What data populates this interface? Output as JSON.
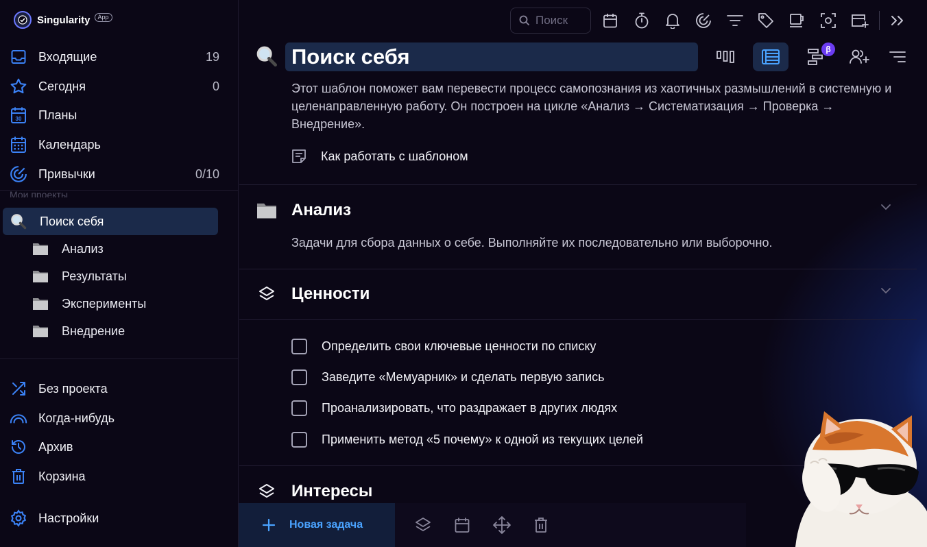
{
  "app": {
    "name": "Singularity",
    "badge": "App"
  },
  "sidebar": {
    "nav": [
      {
        "label": "Входящие",
        "count": "19",
        "icon": "inbox-icon"
      },
      {
        "label": "Сегодня",
        "count": "0",
        "icon": "star-icon"
      },
      {
        "label": "Планы",
        "count": "",
        "icon": "calendar-30-icon"
      },
      {
        "label": "Календарь",
        "count": "",
        "icon": "calendar-grid-icon"
      },
      {
        "label": "Привычки",
        "count": "0/10",
        "icon": "target-icon"
      }
    ],
    "projects_caption": "Мои проекты",
    "active_project": {
      "label": "Поиск себя",
      "icon": "magnifier-emoji-icon"
    },
    "sub_projects": [
      {
        "label": "Анализ",
        "icon": "folder-icon"
      },
      {
        "label": "Результаты",
        "icon": "folder-icon"
      },
      {
        "label": "Эксперименты",
        "icon": "folder-icon"
      },
      {
        "label": "Внедрение",
        "icon": "folder-icon"
      }
    ],
    "bottom_nav": [
      {
        "label": "Без проекта",
        "icon": "shuffle-icon"
      },
      {
        "label": "Когда-нибудь",
        "icon": "rainbow-icon"
      },
      {
        "label": "Архив",
        "icon": "history-icon"
      },
      {
        "label": "Корзина",
        "icon": "trash-icon"
      }
    ],
    "settings": {
      "label": "Настройки",
      "icon": "gear-icon"
    }
  },
  "toolbar": {
    "search_placeholder": "Поиск",
    "icons": [
      "calendar-icon",
      "stopwatch-icon",
      "bell-icon",
      "target-icon",
      "filter-icon",
      "tag-icon",
      "mug-icon",
      "scan-icon",
      "add-window-icon",
      "expand-icon"
    ]
  },
  "project": {
    "title": "Поиск себя",
    "description": "Этот шаблон поможет вам перевести процесс самопознания из хаотичных размышлений в системную и целенаправленную работу. Он построен на цикле «Анализ → Систематизация → Проверка → Внедрение».",
    "howto_label": "Как работать с шаблоном",
    "view_icons": [
      "kanban-icon",
      "list-icon",
      "gantt-icon",
      "add-user-icon",
      "sort-icon"
    ],
    "beta_label": "β"
  },
  "sections": [
    {
      "label": "Анализ",
      "icon": "folder-icon",
      "description": "Задачи для сбора данных о себе. Выполняйте их последовательно или выборочно."
    },
    {
      "label": "Ценности",
      "icon": "layers-icon",
      "tasks": [
        "Определить свои ключевые ценности по списку",
        "Заведите «Мемуарник» и сделать первую запись",
        "Проанализировать, что раздражает в других людях",
        "Применить метод «5 почему» к одной из текущих целей"
      ]
    },
    {
      "label": "Интересы",
      "icon": "layers-icon"
    }
  ],
  "bottom_bar": {
    "new_task_label": "Новая задача",
    "icons": [
      "layers-icon",
      "calendar-icon",
      "move-icon",
      "trash-icon"
    ]
  },
  "colors": {
    "background": "#0b0716",
    "active_bg": "#1b2a4a",
    "accent": "#4aa3ff",
    "beta": "#6b3cf2",
    "icon_blue": "#3b82f6"
  }
}
